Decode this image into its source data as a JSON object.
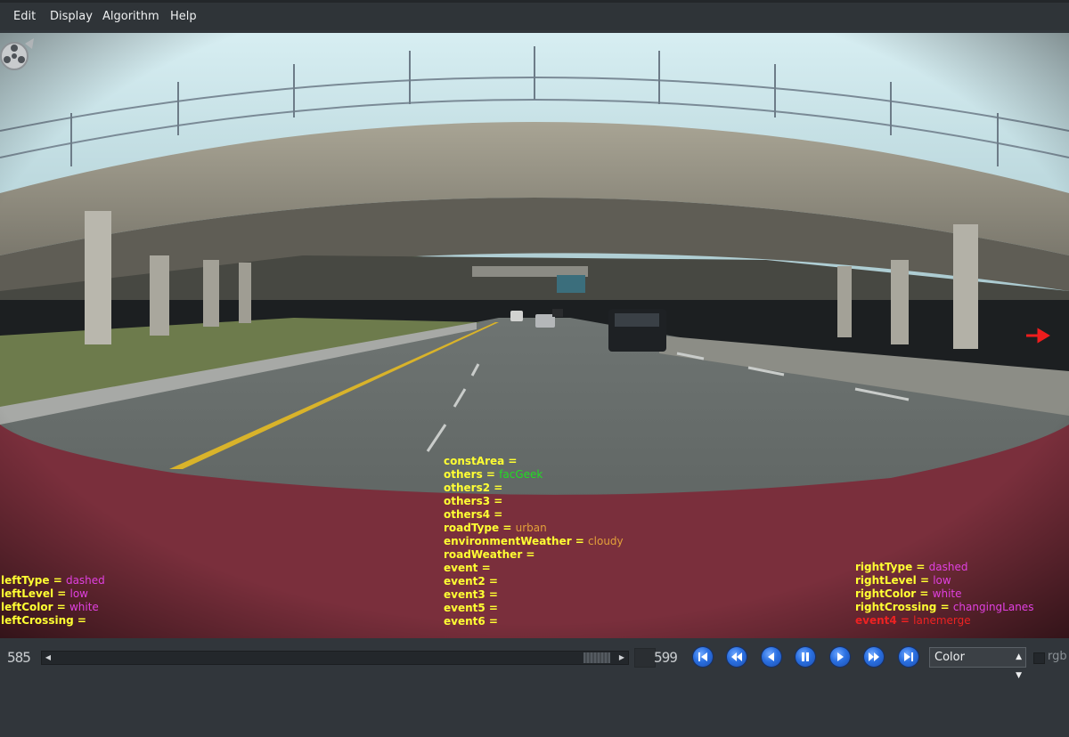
{
  "menu": [
    "Edit",
    "Display",
    "Algorithm",
    "Help"
  ],
  "overlay": {
    "center": [
      {
        "key": "constArea",
        "value": "",
        "color": "#ffff33"
      },
      {
        "key": "others",
        "value": "facGeek",
        "color": "#22dd22"
      },
      {
        "key": "others2",
        "value": "",
        "color": "#ffff33"
      },
      {
        "key": "others3",
        "value": "",
        "color": "#ffff33"
      },
      {
        "key": "others4",
        "value": "",
        "color": "#ffff33"
      },
      {
        "key": "roadType",
        "value": "urban",
        "color": "#e3a03a"
      },
      {
        "key": "environmentWeather",
        "value": "cloudy",
        "color": "#e3a03a"
      },
      {
        "key": "roadWeather",
        "value": "",
        "color": "#ffff33"
      },
      {
        "key": "event",
        "value": "",
        "color": "#ffff33"
      },
      {
        "key": "event2",
        "value": "",
        "color": "#ffff33"
      },
      {
        "key": "event3",
        "value": "",
        "color": "#ffff33"
      },
      {
        "key": "event5",
        "value": "",
        "color": "#ffff33"
      },
      {
        "key": "event6",
        "value": "",
        "color": "#ffff33"
      }
    ],
    "left": [
      {
        "key": "leftType",
        "value": "dashed",
        "color": "#e040e0"
      },
      {
        "key": "leftLevel",
        "value": "low",
        "color": "#e040e0"
      },
      {
        "key": "leftColor",
        "value": "white",
        "color": "#e040e0"
      },
      {
        "key": "leftCrossing",
        "value": "",
        "color": "#e040e0"
      }
    ],
    "right": [
      {
        "key": "rightType",
        "value": "dashed",
        "color": "#e040e0"
      },
      {
        "key": "rightLevel",
        "value": "low",
        "color": "#e040e0"
      },
      {
        "key": "rightColor",
        "value": "white",
        "color": "#e040e0"
      },
      {
        "key": "rightCrossing",
        "value": "changingLanes",
        "color": "#e040e0"
      },
      {
        "key": "event4",
        "value": "lanemerge",
        "color": "#ee2222",
        "key_color": "#ee2222"
      }
    ]
  },
  "controls": {
    "current_frame": "585",
    "total_frames": "599",
    "color_mode": "Color",
    "rgb_label": "rgb",
    "buttons": [
      "first-frame",
      "rewind",
      "step-back",
      "pause",
      "play",
      "fast-forward",
      "last-frame"
    ]
  },
  "colors": {
    "hood": "#7a2f3c",
    "road": "#5d6360",
    "bridge": "#8f8c80",
    "sky": "#cfe4ea",
    "lane_yellow": "#d9b32a"
  }
}
